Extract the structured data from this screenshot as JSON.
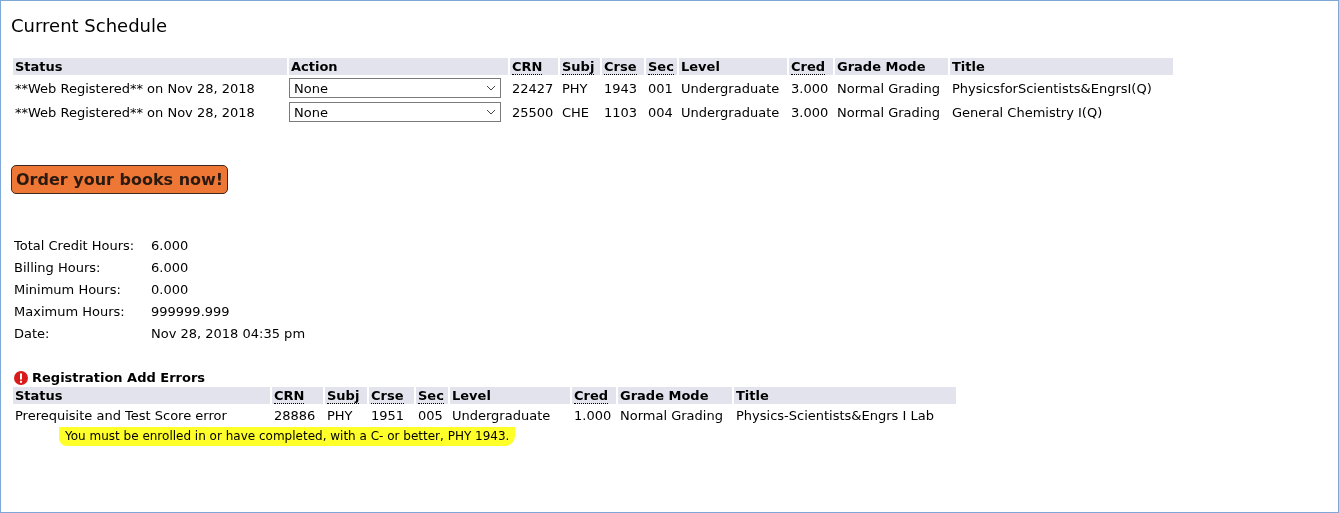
{
  "title": "Current Schedule",
  "schedule": {
    "columns": [
      {
        "label": "Status",
        "abbr": false
      },
      {
        "label": "Action",
        "abbr": false
      },
      {
        "label": "CRN",
        "abbr": true
      },
      {
        "label": "Subj",
        "abbr": true
      },
      {
        "label": "Crse",
        "abbr": true
      },
      {
        "label": "Sec",
        "abbr": true
      },
      {
        "label": "Level",
        "abbr": false
      },
      {
        "label": "Cred",
        "abbr": true
      },
      {
        "label": "Grade Mode",
        "abbr": false
      },
      {
        "label": "Title",
        "abbr": false
      }
    ],
    "rows": [
      {
        "status": "**Web Registered** on Nov 28, 2018",
        "action": "None",
        "crn": "22427",
        "subj": "PHY",
        "crse": "1943",
        "sec": "001",
        "level": "Undergraduate",
        "cred": "3.000",
        "grade_mode": "Normal Grading",
        "title": "PhysicsforScientists&EngrsI(Q)"
      },
      {
        "status": "**Web Registered** on Nov 28, 2018",
        "action": "None",
        "crn": "25500",
        "subj": "CHE",
        "crse": "1103",
        "sec": "004",
        "level": "Undergraduate",
        "cred": "3.000",
        "grade_mode": "Normal Grading",
        "title": "General Chemistry I(Q)"
      }
    ]
  },
  "order_button": "Order your books now!",
  "summary": [
    {
      "label": "Total Credit Hours:",
      "value": "6.000"
    },
    {
      "label": "Billing Hours:",
      "value": "6.000"
    },
    {
      "label": "Minimum Hours:",
      "value": "0.000"
    },
    {
      "label": "Maximum Hours:",
      "value": "999999.999"
    },
    {
      "label": "Date:",
      "value": "Nov 28, 2018 04:35 pm"
    }
  ],
  "errors": {
    "heading": "Registration Add Errors",
    "columns": [
      {
        "label": "Status",
        "abbr": false
      },
      {
        "label": "CRN",
        "abbr": true
      },
      {
        "label": "Subj",
        "abbr": true
      },
      {
        "label": "Crse",
        "abbr": true
      },
      {
        "label": "Sec",
        "abbr": true
      },
      {
        "label": "Level",
        "abbr": false
      },
      {
        "label": "Cred",
        "abbr": true
      },
      {
        "label": "Grade Mode",
        "abbr": false
      },
      {
        "label": "Title",
        "abbr": false
      }
    ],
    "rows": [
      {
        "status": "Prerequisite and Test Score error",
        "crn": "28886",
        "subj": "PHY",
        "crse": "1951",
        "sec": "005",
        "level": "Undergraduate",
        "cred": "1.000",
        "grade_mode": "Normal Grading",
        "title": "Physics-Scientists&Engrs I Lab",
        "message": "You must be enrolled in or have completed, with a C- or better, PHY 1943."
      }
    ]
  }
}
